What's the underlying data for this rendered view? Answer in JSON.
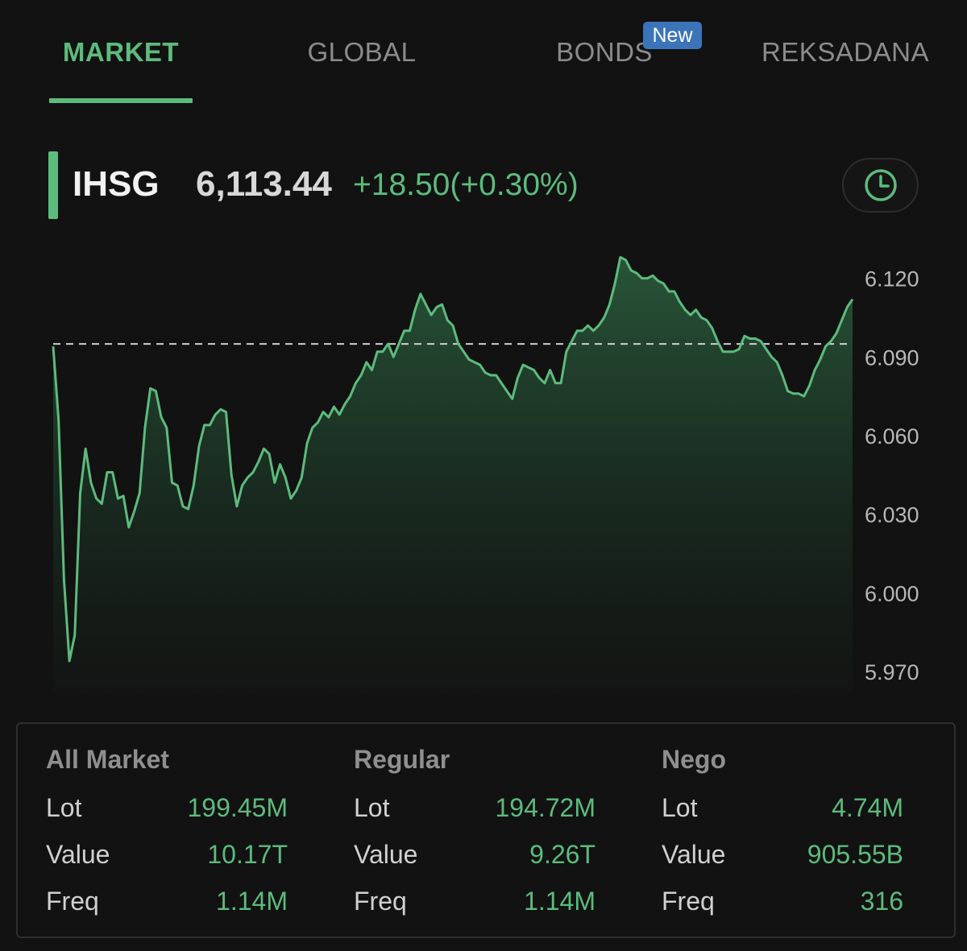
{
  "tabs": [
    {
      "label": "MARKET",
      "active": true
    },
    {
      "label": "GLOBAL",
      "active": false
    },
    {
      "label": "BONDS",
      "active": false,
      "badge": "New"
    },
    {
      "label": "REKSADANA",
      "active": false
    }
  ],
  "index": {
    "name": "IHSG",
    "value": "6,113.44",
    "change": "+18.50(+0.30%)"
  },
  "icons": {
    "history": "clock-icon"
  },
  "colors": {
    "accent": "#5dbb7d",
    "badge": "#3b74b8",
    "background": "#121212"
  },
  "chart_data": {
    "type": "area",
    "y_ticks": [
      "6.120",
      "6.090",
      "6.060",
      "6.030",
      "6.000",
      "5.970"
    ],
    "ylim": [
      5962,
      6134
    ],
    "reference_line": 6094.94,
    "series": [
      {
        "values": [
          6094,
          6066,
          6005,
          5974,
          5984,
          6038,
          6055,
          6042,
          6036,
          6034,
          6046,
          6046,
          6036,
          6037,
          6025,
          6031,
          6038,
          6063,
          6078,
          6077,
          6067,
          6063,
          6042,
          6041,
          6033,
          6032,
          6041,
          6056,
          6064,
          6064,
          6068,
          6070,
          6069,
          6045,
          6033,
          6041,
          6044,
          6046,
          6050,
          6055,
          6053,
          6042,
          6049,
          6044,
          6036,
          6039,
          6044,
          6057,
          6063,
          6065,
          6069,
          6067,
          6071,
          6068,
          6072,
          6075,
          6080,
          6083,
          6088,
          6085,
          6092,
          6092,
          6095,
          6090,
          6095,
          6100,
          6100,
          6108,
          6114,
          6110,
          6106,
          6109,
          6110,
          6104,
          6102,
          6095,
          6092,
          6089,
          6088,
          6087,
          6084,
          6083,
          6083,
          6080,
          6077,
          6074,
          6082,
          6087,
          6086,
          6085,
          6082,
          6080,
          6085,
          6080,
          6080,
          6092,
          6096,
          6100,
          6100,
          6102,
          6100,
          6102,
          6105,
          6110,
          6118,
          6128,
          6127,
          6123,
          6122,
          6120,
          6120,
          6121,
          6119,
          6118,
          6115,
          6115,
          6111,
          6108,
          6106,
          6108,
          6105,
          6104,
          6101,
          6096,
          6092,
          6092,
          6092,
          6093,
          6098,
          6097,
          6097,
          6096,
          6093,
          6090,
          6088,
          6083,
          6077,
          6076,
          6076,
          6075,
          6079,
          6085,
          6089,
          6094,
          6096,
          6099,
          6104,
          6109,
          6112
        ]
      }
    ]
  },
  "stats": [
    {
      "title": "All Market",
      "rows": [
        {
          "label": "Lot",
          "value": "199.45M"
        },
        {
          "label": "Value",
          "value": "10.17T"
        },
        {
          "label": "Freq",
          "value": "1.14M"
        }
      ]
    },
    {
      "title": "Regular",
      "rows": [
        {
          "label": "Lot",
          "value": "194.72M"
        },
        {
          "label": "Value",
          "value": "9.26T"
        },
        {
          "label": "Freq",
          "value": "1.14M"
        }
      ]
    },
    {
      "title": "Nego",
      "rows": [
        {
          "label": "Lot",
          "value": "4.74M"
        },
        {
          "label": "Value",
          "value": "905.55B"
        },
        {
          "label": "Freq",
          "value": "316"
        }
      ]
    }
  ]
}
